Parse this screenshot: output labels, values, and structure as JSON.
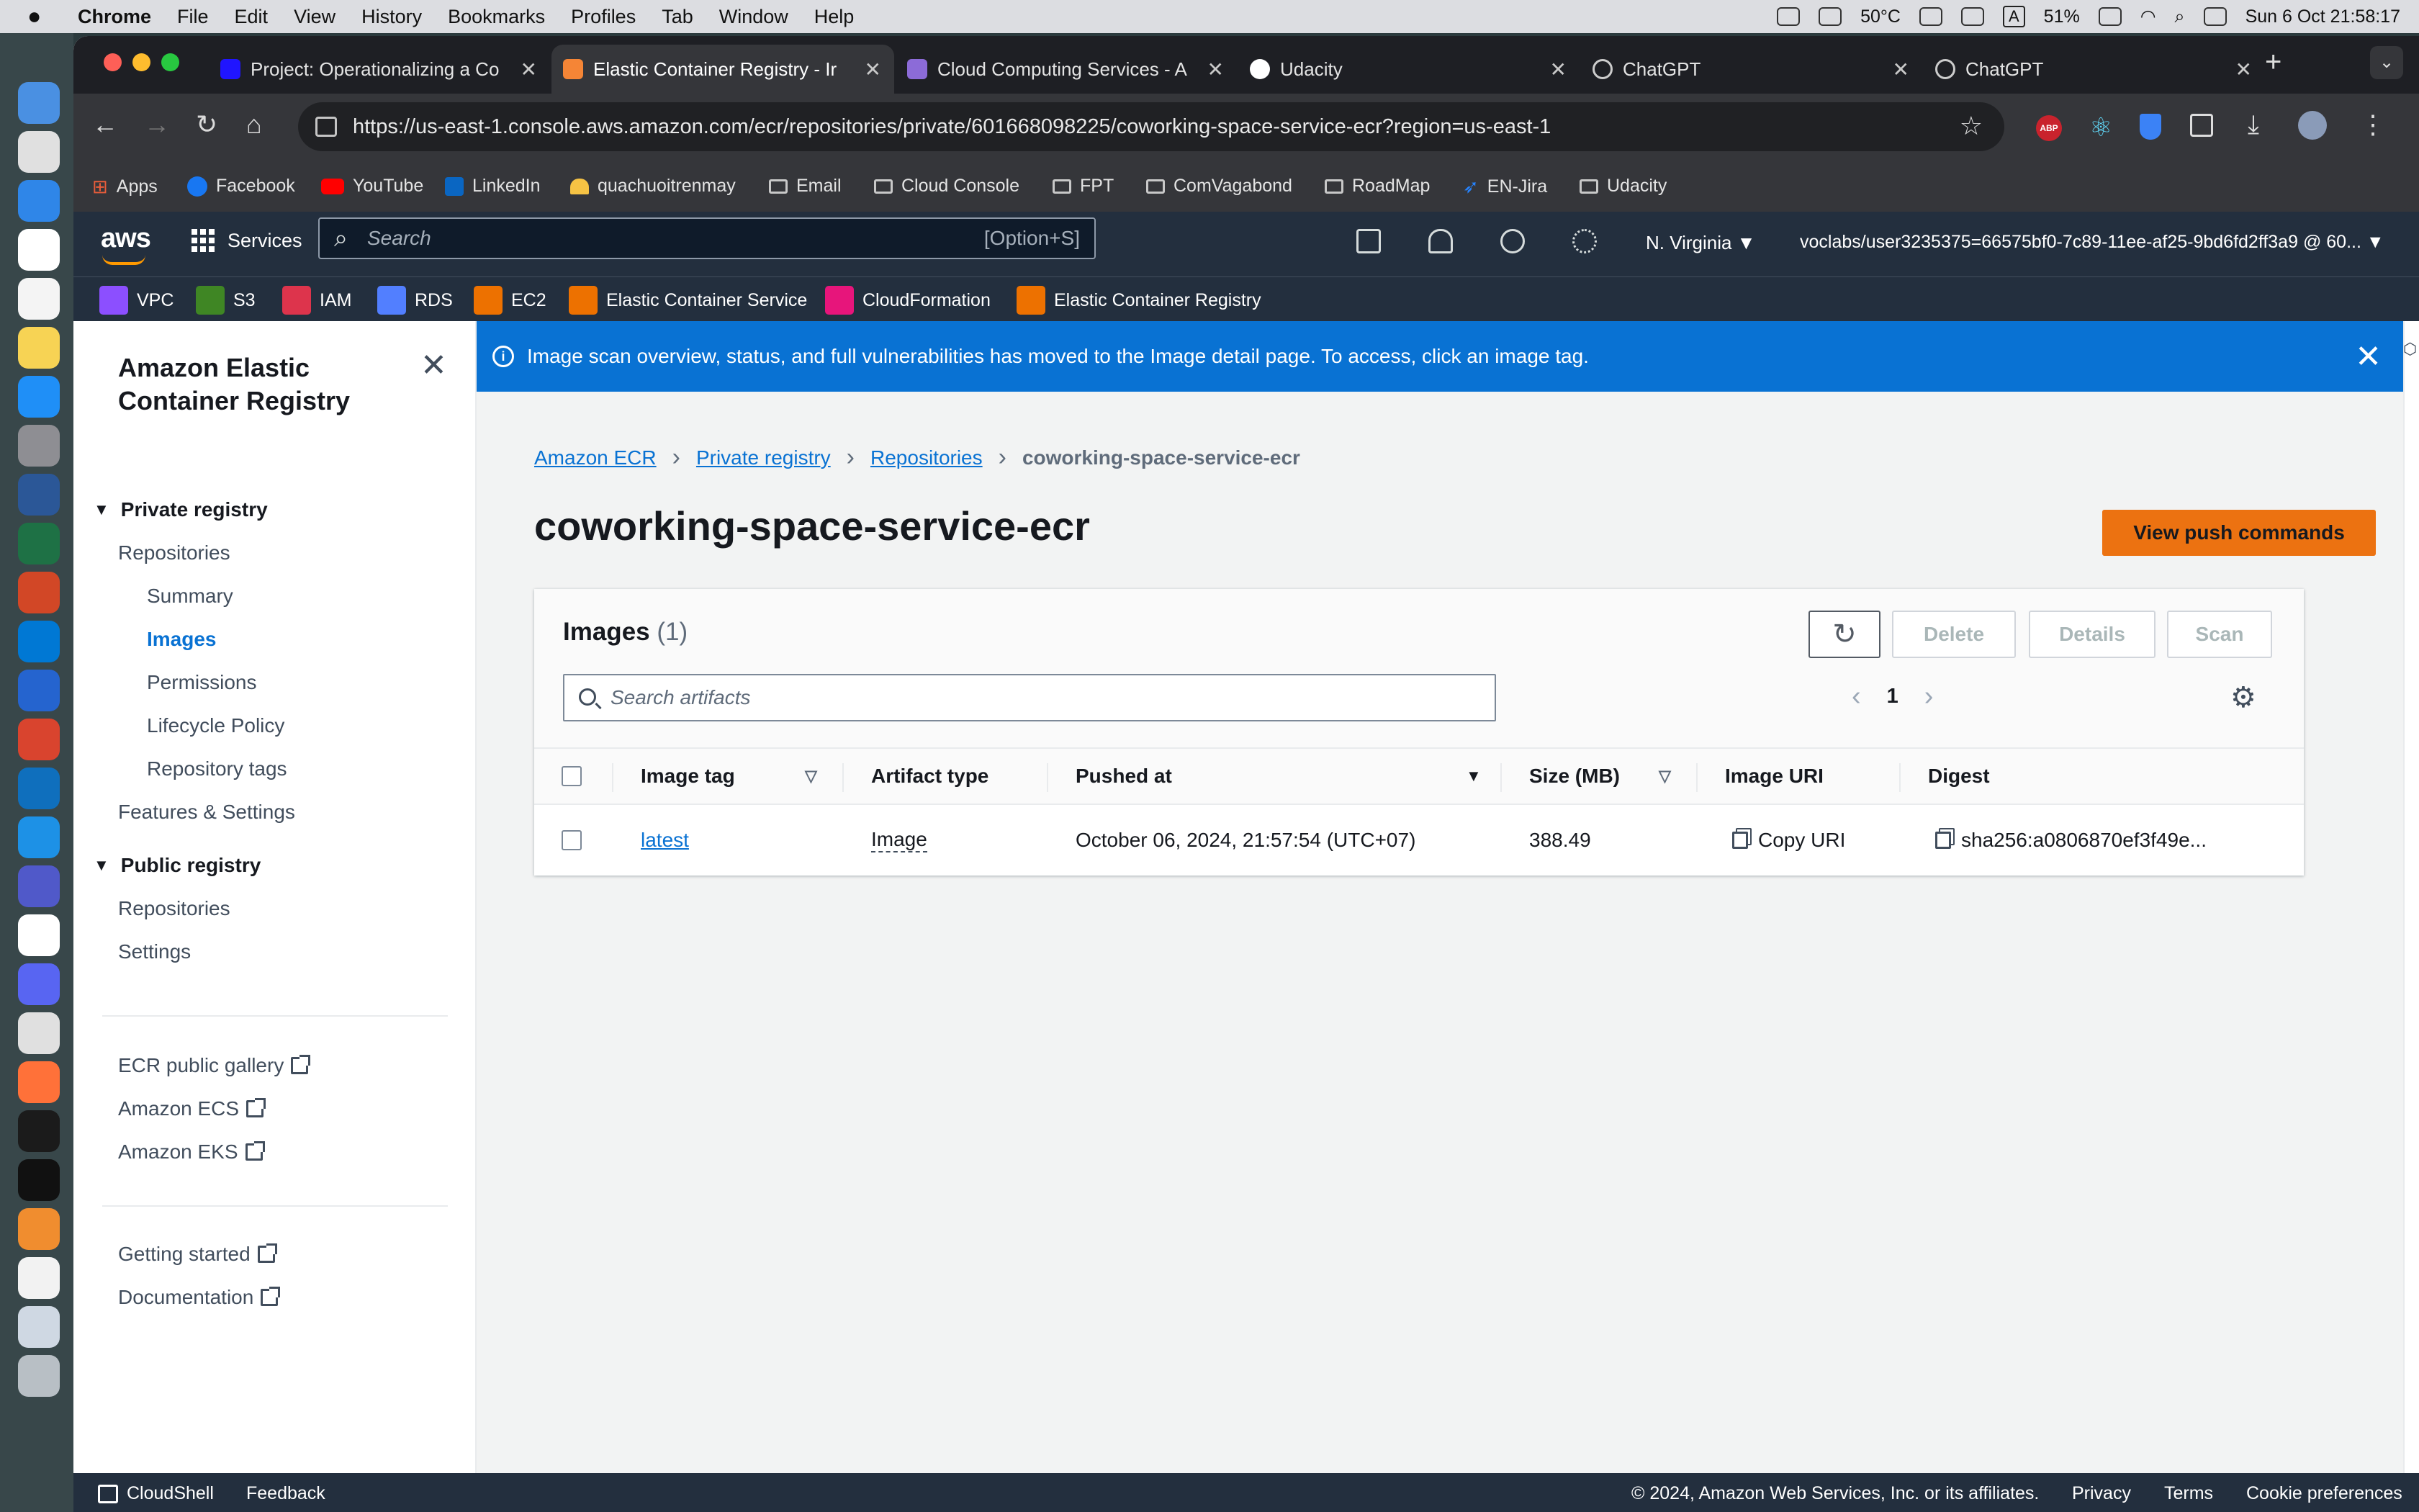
{
  "menubar": {
    "apple": "",
    "items": [
      "Chrome",
      "File",
      "Edit",
      "View",
      "History",
      "Bookmarks",
      "Profiles",
      "Tab",
      "Window",
      "Help"
    ],
    "temperature": "50°C",
    "battery": "51%",
    "datetime": "Sun 6 Oct  21:58:17",
    "input_source": "A"
  },
  "tabs": [
    {
      "title": "Project: Operationalizing a Co",
      "active": false
    },
    {
      "title": "Elastic Container Registry - Ir",
      "active": true
    },
    {
      "title": "Cloud Computing Services - A",
      "active": false
    },
    {
      "title": "Udacity",
      "active": false
    },
    {
      "title": "ChatGPT",
      "active": false
    },
    {
      "title": "ChatGPT",
      "active": false
    }
  ],
  "new_tab": "+",
  "url": "https://us-east-1.console.aws.amazon.com/ecr/repositories/private/601668098225/coworking-space-service-ecr?region=us-east-1",
  "bookmarks": [
    "Apps",
    "Facebook",
    "YouTube",
    "LinkedIn",
    "quachuoitrenmay",
    "Email",
    "Cloud Console",
    "FPT",
    "ComVagabond",
    "RoadMap",
    "EN-Jira",
    "Udacity"
  ],
  "extensions": {
    "abp": "ABP"
  },
  "aws": {
    "logo": "aws",
    "services": "Services",
    "search_placeholder": "Search",
    "search_shortcut": "[Option+S]",
    "region": "N. Virginia ▼",
    "account": "voclabs/user3235375=66575bf0-7c89-11ee-af25-9bd6fd2ff3a9 @ 60... ▼",
    "favorites": [
      "VPC",
      "S3",
      "IAM",
      "RDS",
      "EC2",
      "Elastic Container Service",
      "CloudFormation",
      "Elastic Container Registry"
    ]
  },
  "sidebar": {
    "title": "Amazon Elastic Container Registry",
    "private_registry": "Private registry",
    "private_items": [
      "Repositories",
      "Summary",
      "Images",
      "Permissions",
      "Lifecycle Policy",
      "Repository tags",
      "Features & Settings"
    ],
    "public_registry": "Public registry",
    "public_items": [
      "Repositories",
      "Settings"
    ],
    "external_links": [
      "ECR public gallery",
      "Amazon ECS",
      "Amazon EKS"
    ],
    "help_links": [
      "Getting started",
      "Documentation"
    ]
  },
  "flash": {
    "message": "Image scan overview, status, and full vulnerabilities has moved to the Image detail page. To access, click an image tag."
  },
  "breadcrumb": [
    "Amazon ECR",
    "Private registry",
    "Repositories",
    "coworking-space-service-ecr"
  ],
  "page_title": "coworking-space-service-ecr",
  "push_button": "View push commands",
  "images_panel": {
    "heading": "Images",
    "count": "(1)",
    "buttons": {
      "delete": "Delete",
      "details": "Details",
      "scan": "Scan"
    },
    "search_placeholder": "Search artifacts",
    "page": "1",
    "columns": [
      "Image tag",
      "Artifact type",
      "Pushed at",
      "Size (MB)",
      "Image URI",
      "Digest"
    ],
    "rows": [
      {
        "tag": "latest",
        "artifact_type": "Image",
        "pushed_at": "October 06, 2024, 21:57:54 (UTC+07)",
        "size": "388.49",
        "uri": "Copy URI",
        "digest": "sha256:a0806870ef3f49e..."
      }
    ]
  },
  "footer": {
    "cloudshell": "CloudShell",
    "feedback": "Feedback",
    "copyright": "© 2024, Amazon Web Services, Inc. or its affiliates.",
    "privacy": "Privacy",
    "terms": "Terms",
    "cookies": "Cookie preferences"
  },
  "colors": {
    "aws_header": "#232f3e",
    "link_blue": "#0972d3",
    "primary_button": "#ec7211",
    "flash_blue": "#0972d3"
  }
}
